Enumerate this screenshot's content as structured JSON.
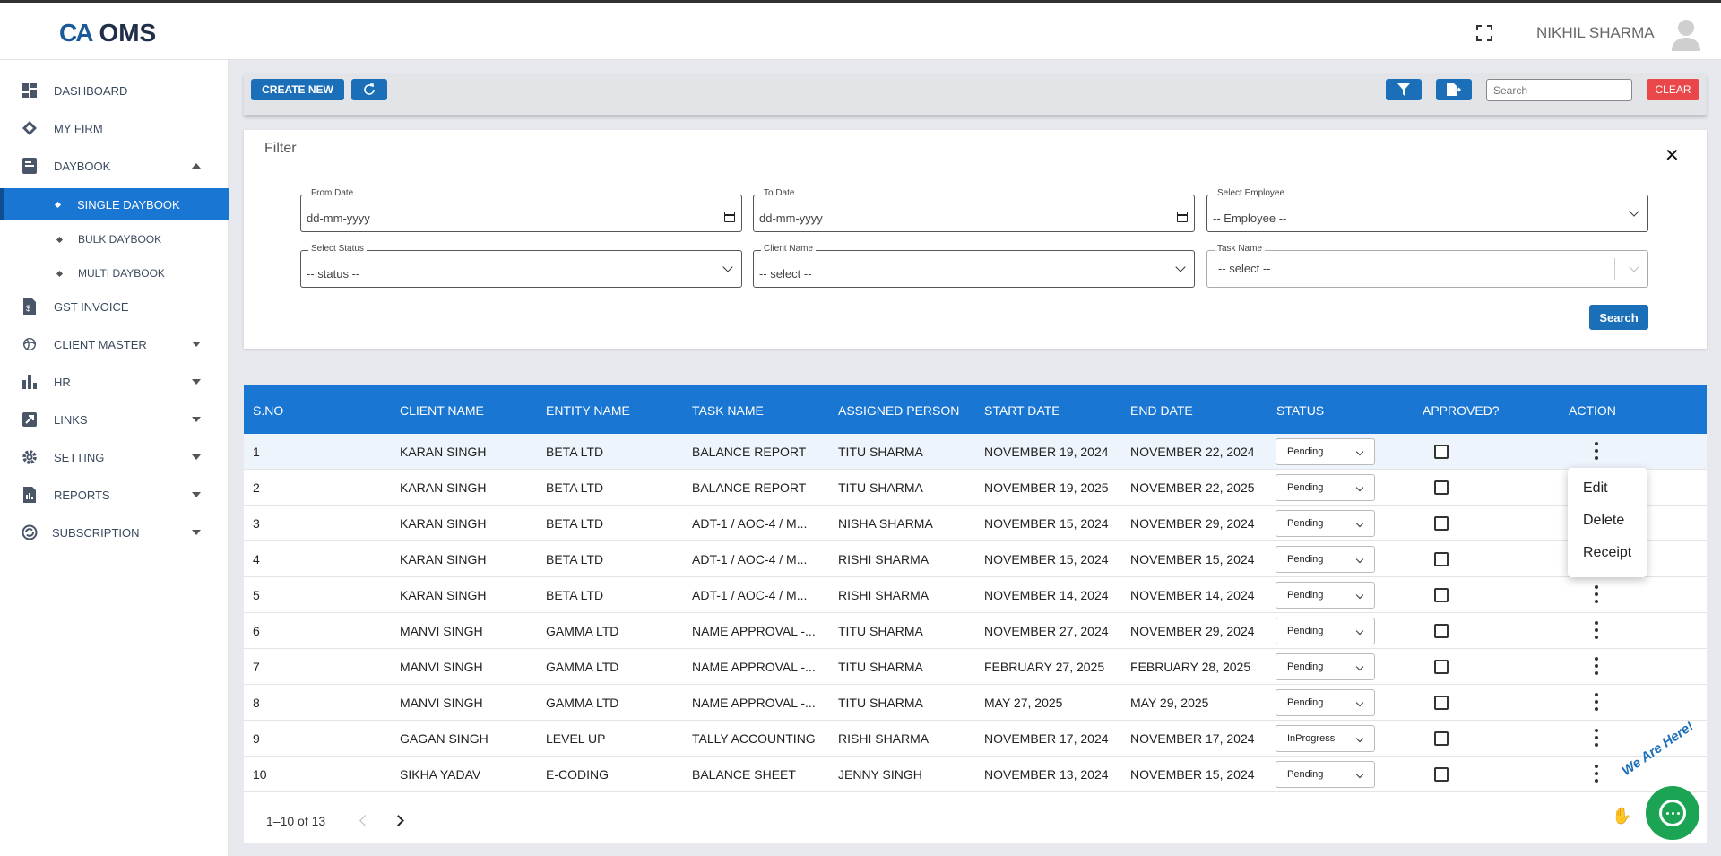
{
  "app": {
    "logo_mark": "CA",
    "logo_text": "OMS",
    "user_name": "NIKHIL SHARMA"
  },
  "sidebar": {
    "items": [
      {
        "label": "DASHBOARD",
        "icon": "dashboard-icon"
      },
      {
        "label": "MY FIRM",
        "icon": "firm-icon"
      },
      {
        "label": "DAYBOOK",
        "icon": "daybook-icon"
      },
      {
        "label": "GST INVOICE",
        "icon": "invoice-icon"
      },
      {
        "label": "CLIENT MASTER",
        "icon": "client-icon"
      },
      {
        "label": "HR",
        "icon": "hr-icon"
      },
      {
        "label": "LINKS",
        "icon": "links-icon"
      },
      {
        "label": "SETTING",
        "icon": "gear-icon"
      },
      {
        "label": "REPORTS",
        "icon": "reports-icon"
      },
      {
        "label": "SUBSCRIPTION",
        "icon": "subscription-icon"
      }
    ],
    "daybook_sub": [
      "SINGLE DAYBOOK",
      "BULK DAYBOOK",
      "MULTI DAYBOOK"
    ]
  },
  "toolbar": {
    "create_new": "CREATE NEW",
    "search_placeholder": "Search",
    "clear": "CLEAR"
  },
  "filter": {
    "title": "Filter",
    "from_date": {
      "label": "From Date",
      "value": "dd-mm-yyyy"
    },
    "to_date": {
      "label": "To Date",
      "value": "dd-mm-yyyy"
    },
    "employee": {
      "label": "Select Employee",
      "value": "-- Employee --"
    },
    "status": {
      "label": "Select Status",
      "value": "-- status --"
    },
    "client": {
      "label": "Client Name",
      "value": "-- select --"
    },
    "task": {
      "label": "Task Name",
      "value": "-- select --"
    },
    "search_button": "Search"
  },
  "table": {
    "headers": [
      "S.NO",
      "CLIENT NAME",
      "ENTITY NAME",
      "TASK NAME",
      "ASSIGNED PERSON",
      "START DATE",
      "END DATE",
      "STATUS",
      "APPROVED?",
      "ACTION"
    ],
    "rows": [
      [
        "1",
        "KARAN SINGH",
        "BETA LTD",
        "BALANCE REPORT",
        "TITU SHARMA",
        "NOVEMBER 19, 2024",
        "NOVEMBER 22, 2024",
        "Pending"
      ],
      [
        "2",
        "KARAN SINGH",
        "BETA LTD",
        "BALANCE REPORT",
        "TITU SHARMA",
        "NOVEMBER 19, 2025",
        "NOVEMBER 22, 2025",
        "Pending"
      ],
      [
        "3",
        "KARAN SINGH",
        "BETA LTD",
        "ADT-1 / AOC-4 / M...",
        "NISHA SHARMA",
        "NOVEMBER 15, 2024",
        "NOVEMBER 29, 2024",
        "Pending"
      ],
      [
        "4",
        "KARAN SINGH",
        "BETA LTD",
        "ADT-1 / AOC-4 / M...",
        "RISHI SHARMA",
        "NOVEMBER 15, 2024",
        "NOVEMBER 15, 2024",
        "Pending"
      ],
      [
        "5",
        "KARAN SINGH",
        "BETA LTD",
        "ADT-1 / AOC-4 / M...",
        "RISHI SHARMA",
        "NOVEMBER 14, 2024",
        "NOVEMBER 14, 2024",
        "Pending"
      ],
      [
        "6",
        "MANVI SINGH",
        "GAMMA LTD",
        "NAME APPROVAL -...",
        "TITU SHARMA",
        "NOVEMBER 27, 2024",
        "NOVEMBER 29, 2024",
        "Pending"
      ],
      [
        "7",
        "MANVI SINGH",
        "GAMMA LTD",
        "NAME APPROVAL -...",
        "TITU SHARMA",
        "FEBRUARY 27, 2025",
        "FEBRUARY 28, 2025",
        "Pending"
      ],
      [
        "8",
        "MANVI SINGH",
        "GAMMA LTD",
        "NAME APPROVAL -...",
        "TITU SHARMA",
        "MAY 27, 2025",
        "MAY 29, 2025",
        "Pending"
      ],
      [
        "9",
        "GAGAN SINGH",
        "LEVEL UP",
        "TALLY ACCOUNTING",
        "RISHI SHARMA",
        "NOVEMBER 17, 2024",
        "NOVEMBER 17, 2024",
        "InProgress"
      ],
      [
        "10",
        "SIKHA YADAV",
        "E-CODING",
        "BALANCE SHEET",
        "JENNY SINGH",
        "NOVEMBER 13, 2024",
        "NOVEMBER 15, 2024",
        "Pending"
      ]
    ],
    "pagination": "1–10 of 13"
  },
  "action_menu": [
    "Edit",
    "Delete",
    "Receipt"
  ],
  "chat": {
    "tag": "We Are Here!"
  },
  "colors": {
    "primary": "#1976d2",
    "button": "#1a6fb8",
    "danger": "#e9474a",
    "chat": "#1aa453"
  }
}
